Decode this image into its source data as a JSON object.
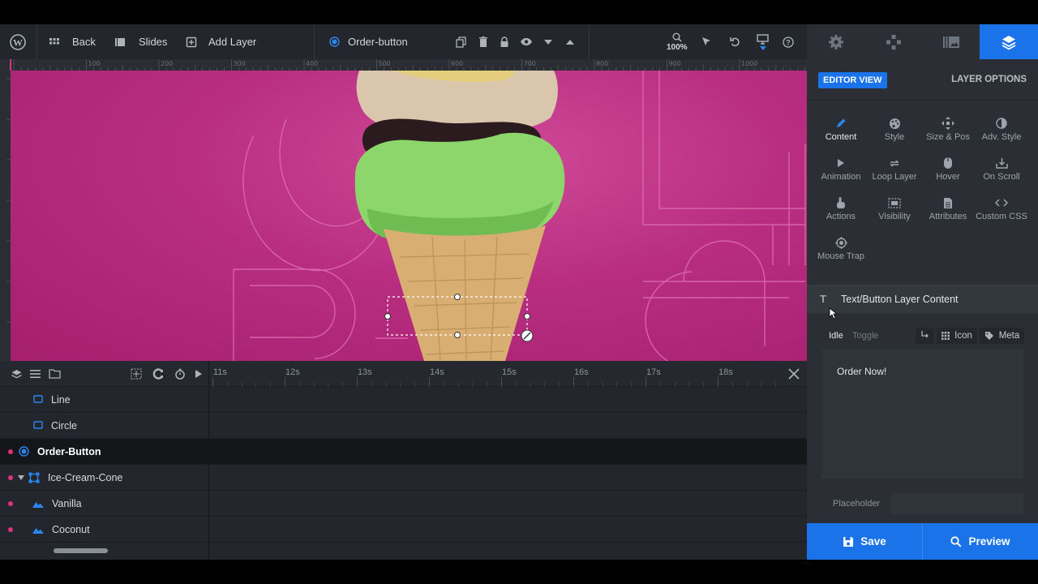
{
  "toolbar": {
    "back_label": "Back",
    "slides_label": "Slides",
    "add_layer_label": "Add Layer",
    "current_layer": "Order-button",
    "zoom_level": "100%"
  },
  "ruler": {
    "marks": [
      "100",
      "200",
      "300",
      "400",
      "500",
      "600",
      "700",
      "800",
      "900",
      "1000"
    ]
  },
  "timeline": {
    "ticks": [
      "11s",
      "12s",
      "13s",
      "14s",
      "15s",
      "16s",
      "17s",
      "18s"
    ],
    "layers": [
      {
        "name": "Line"
      },
      {
        "name": "Circle"
      },
      {
        "name": "Order-Button"
      },
      {
        "name": "Ice-Cream-Cone"
      },
      {
        "name": "Vanilla"
      },
      {
        "name": "Coconut"
      }
    ]
  },
  "panel": {
    "editor_view": "EDITOR VIEW",
    "layer_options": "LAYER OPTIONS",
    "options": [
      {
        "label": "Content",
        "icon": "pencil-icon"
      },
      {
        "label": "Style",
        "icon": "palette-icon"
      },
      {
        "label": "Size & Pos",
        "icon": "move-icon"
      },
      {
        "label": "Adv. Style",
        "icon": "contrast-icon"
      },
      {
        "label": "Animation",
        "icon": "play-icon"
      },
      {
        "label": "Loop Layer",
        "icon": "loop-icon"
      },
      {
        "label": "Hover",
        "icon": "mouse-icon"
      },
      {
        "label": "On Scroll",
        "icon": "download-icon"
      },
      {
        "label": "Actions",
        "icon": "hand-icon"
      },
      {
        "label": "Visibility",
        "icon": "visibility-icon"
      },
      {
        "label": "Attributes",
        "icon": "document-icon"
      },
      {
        "label": "Custom CSS",
        "icon": "code-icon"
      },
      {
        "label": "Mouse Trap",
        "icon": "crosshair-icon"
      }
    ],
    "section_title": "Text/Button Layer Content",
    "tab_idle": "Idle",
    "tab_toggle": "Toggle",
    "icon_label": "Icon",
    "meta_label": "Meta",
    "content_text": "Order Now!",
    "placeholder_label": "Placeholder",
    "placeholder_value": ""
  },
  "actions": {
    "save": "Save",
    "preview": "Preview"
  },
  "colors": {
    "accent": "#1f6fe0",
    "active_tab": "#1a73e8",
    "layer_dot": "#e0307f",
    "canvas_bg": "#b82d80"
  }
}
